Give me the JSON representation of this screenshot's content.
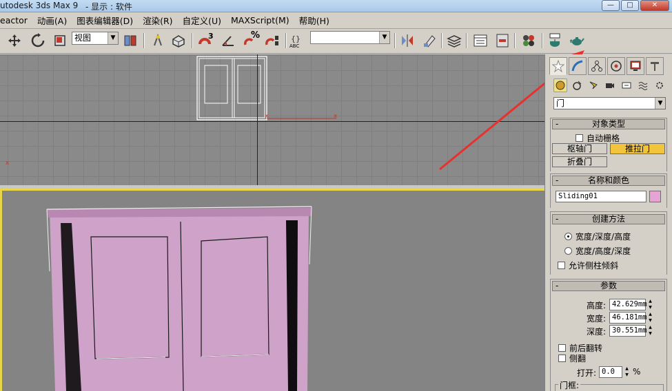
{
  "titlebar": {
    "app_title": "utodesk 3ds Max 9",
    "subtitle": "- 显示 : 软件",
    "minimize": "—",
    "restore": "□",
    "close": "✕"
  },
  "menubar": {
    "items": [
      "eactor",
      "动画(A)",
      "图表编辑器(D)",
      "渲染(R)",
      "自定义(U)",
      "MAXScript(M)",
      "帮助(H)"
    ]
  },
  "toolbar": {
    "view_combo_value": "视图",
    "snap_label_3": "3",
    "pct_label": "%",
    "abc_label": "ABC",
    "named_sel_value": ""
  },
  "viewport_top": {
    "axis_label_x": "x",
    "axis_label_x2": "x"
  },
  "viewport_persp": {
    "object_color": "#cea2c9"
  },
  "cmdpanel": {
    "category_value": "门",
    "object_type": {
      "title": "对象类型",
      "auto_grid": "自动栅格",
      "buttons": [
        "枢轴门",
        "推拉门",
        "折叠门"
      ],
      "active": "推拉门"
    },
    "name_color": {
      "title": "名称和颜色",
      "name": "Sliding01",
      "color": "#e7a3d4"
    },
    "creation": {
      "title": "创建方法",
      "option1": "宽度/深度/高度",
      "option2": "宽度/高度/深度",
      "allow_non_vertical": "允许侧柱倾斜"
    },
    "params": {
      "title": "参数",
      "height_label": "高度:",
      "height_value": "42.629mm",
      "width_label": "宽度:",
      "width_value": "46.181mm",
      "depth_label": "深度:",
      "depth_value": "30.551mm",
      "flip_front_back": "前后翻转",
      "side_flip": "侧翻",
      "open_label": "打开:",
      "open_value": "0.0",
      "open_unit": "%",
      "frame_label": "门框:"
    }
  },
  "colors": {
    "accent_red_arrow": "#e8312e",
    "active_button": "#f2c43b",
    "viewport_border": "#e8d64a"
  }
}
